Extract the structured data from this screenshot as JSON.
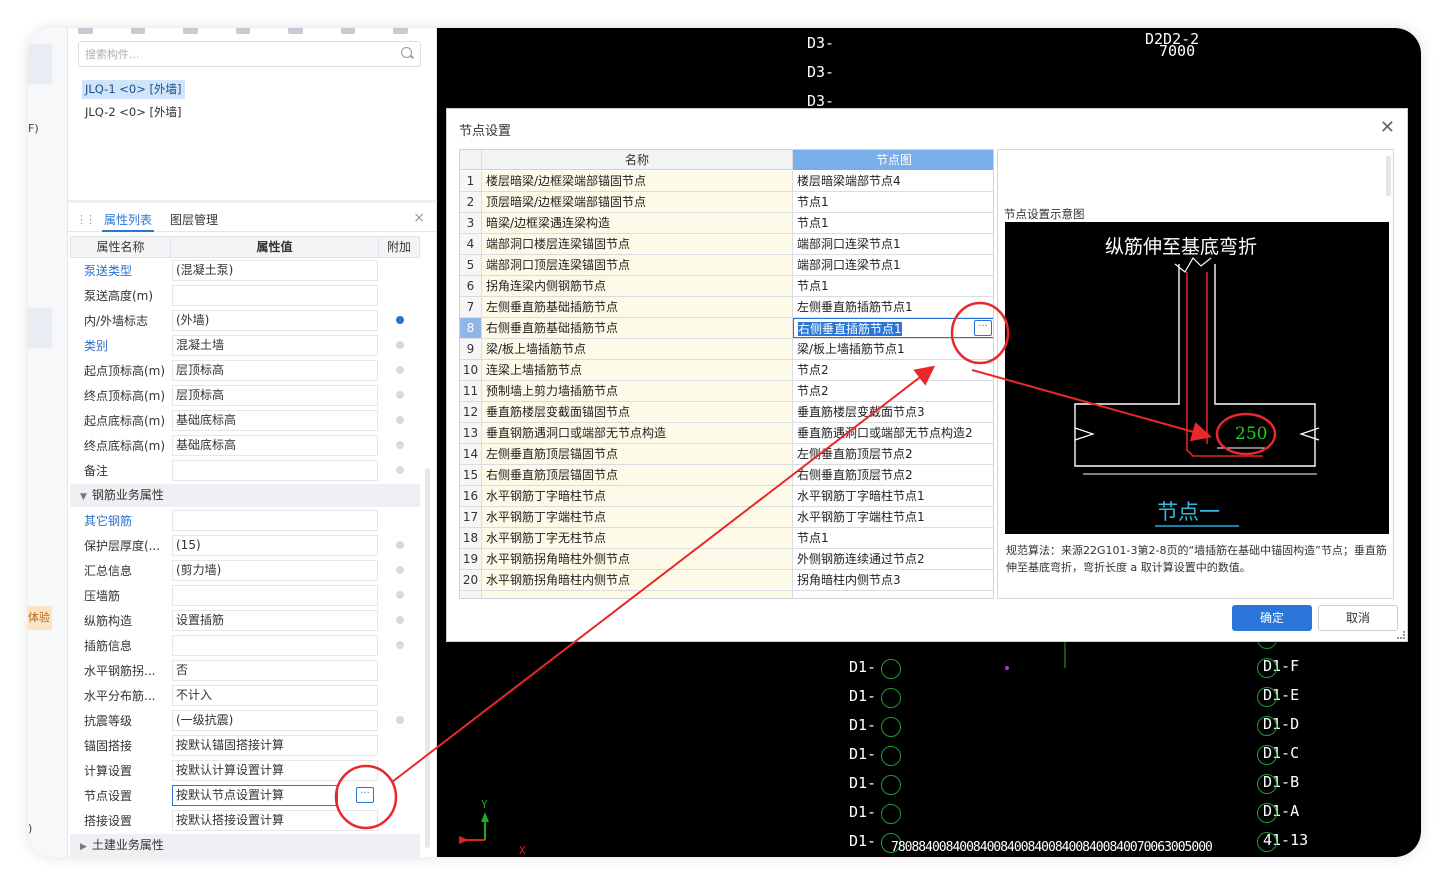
{
  "left_edge": {
    "text_top": "F)",
    "text_bottom": ")",
    "experience_tab": "体验"
  },
  "component_panel": {
    "search_placeholder": "搜索构件...",
    "items": [
      {
        "label": "JLQ-1 <0> [外墙]",
        "selected": true
      },
      {
        "label": "JLQ-2 <0> [外墙]",
        "selected": false
      }
    ]
  },
  "property_panel": {
    "tabs": [
      "属性列表",
      "图层管理"
    ],
    "columns": [
      "属性名称",
      "属性值",
      "附加"
    ],
    "rows": [
      {
        "name": "泵送类型",
        "value": "(混凝土泵)",
        "link": true,
        "dot": "none"
      },
      {
        "name": "泵送高度(m)",
        "value": "",
        "link": false,
        "dot": "none"
      },
      {
        "name": "内/外墙标志",
        "value": "(外墙)",
        "link": false,
        "dot": "blue"
      },
      {
        "name": "类别",
        "value": "混凝土墙",
        "link": true,
        "dot": "grey"
      },
      {
        "name": "起点顶标高(m)",
        "value": "层顶标高",
        "link": false,
        "dot": "grey"
      },
      {
        "name": "终点顶标高(m)",
        "value": "层顶标高",
        "link": false,
        "dot": "grey"
      },
      {
        "name": "起点底标高(m)",
        "value": "基础底标高",
        "link": false,
        "dot": "grey"
      },
      {
        "name": "终点底标高(m)",
        "value": "基础底标高",
        "link": false,
        "dot": "grey"
      },
      {
        "name": "备注",
        "value": "",
        "link": false,
        "dot": "grey"
      }
    ],
    "group_rebar": "钢筋业务属性",
    "rebar_rows": [
      {
        "name": "其它钢筋",
        "value": "",
        "link": true,
        "dot": "none"
      },
      {
        "name": "保护层厚度(...",
        "value": "(15)",
        "link": false,
        "dot": "grey"
      },
      {
        "name": "汇总信息",
        "value": "(剪力墙)",
        "link": false,
        "dot": "grey"
      },
      {
        "name": "压墙筋",
        "value": "",
        "link": false,
        "dot": "grey"
      },
      {
        "name": "纵筋构造",
        "value": "设置插筋",
        "link": false,
        "dot": "grey"
      },
      {
        "name": "插筋信息",
        "value": "",
        "link": false,
        "dot": "grey"
      },
      {
        "name": "水平钢筋拐...",
        "value": "否",
        "link": false,
        "dot": "none"
      },
      {
        "name": "水平分布筋...",
        "value": "不计入",
        "link": false,
        "dot": "none"
      },
      {
        "name": "抗震等级",
        "value": "(一级抗震)",
        "link": false,
        "dot": "grey"
      },
      {
        "name": "锚固搭接",
        "value": "按默认锚固搭接计算",
        "link": false,
        "dot": "none"
      },
      {
        "name": "计算设置",
        "value": "按默认计算设置计算",
        "link": false,
        "dot": "none"
      },
      {
        "name": "节点设置",
        "value": "按默认节点设置计算",
        "link": false,
        "dot": "none"
      },
      {
        "name": "搭接设置",
        "value": "按默认搭接设置计算",
        "link": false,
        "dot": "none"
      }
    ],
    "group_civil": "土建业务属性"
  },
  "cad": {
    "labels_top": [
      "D3-",
      "D3-",
      "D3-",
      "D2D2-2",
      "7000"
    ],
    "labels_left": [
      "D1-",
      "D1-",
      "D1-",
      "D1-",
      "D1-",
      "D1-",
      "D1-",
      "41-1"
    ],
    "labels_right": [
      "D1-G",
      "D1-F",
      "D1-E",
      "D1-D",
      "D1-C",
      "D1-B",
      "D1-A",
      "41-13"
    ],
    "bottom_dims": "78088400840084008400840084008400840070063005000",
    "axis_x": "X",
    "axis_y": "Y"
  },
  "dialog": {
    "title": "节点设置",
    "columns": [
      "名称",
      "节点图"
    ],
    "rows": [
      {
        "no": "1",
        "name": "楼层暗梁/边框梁端部锚固节点",
        "node": "楼层暗梁端部节点4"
      },
      {
        "no": "2",
        "name": "顶层暗梁/边框梁端部锚固节点",
        "node": "节点1"
      },
      {
        "no": "3",
        "name": "暗梁/边框梁遇连梁构造",
        "node": "节点1"
      },
      {
        "no": "4",
        "name": "端部洞口楼层连梁锚固节点",
        "node": "端部洞口连梁节点1"
      },
      {
        "no": "5",
        "name": "端部洞口顶层连梁锚固节点",
        "node": "端部洞口连梁节点1"
      },
      {
        "no": "6",
        "name": "拐角连梁内侧钢筋节点",
        "node": "节点1"
      },
      {
        "no": "7",
        "name": "左侧垂直筋基础插筋节点",
        "node": "左侧垂直筋插筋节点1"
      },
      {
        "no": "8",
        "name": "右侧垂直筋基础插筋节点",
        "node": "右侧垂直插筋节点1"
      },
      {
        "no": "9",
        "name": "梁/板上墙插筋节点",
        "node": "梁/板上墙插筋节点1"
      },
      {
        "no": "10",
        "name": "连梁上墙插筋节点",
        "node": "节点2"
      },
      {
        "no": "11",
        "name": "预制墙上剪力墙插筋节点",
        "node": "节点2"
      },
      {
        "no": "12",
        "name": "垂直筋楼层变截面锚固节点",
        "node": "垂直筋楼层变截面节点3"
      },
      {
        "no": "13",
        "name": "垂直钢筋遇洞口或端部无节点构造",
        "node": "垂直筋遇洞口或端部无节点构造2"
      },
      {
        "no": "14",
        "name": "左侧垂直筋顶层锚固节点",
        "node": "左侧垂直筋顶层节点2"
      },
      {
        "no": "15",
        "name": "右侧垂直筋顶层锚固节点",
        "node": "右侧垂直筋顶层节点2"
      },
      {
        "no": "16",
        "name": "水平钢筋丁字暗柱节点",
        "node": "水平钢筋丁字暗柱节点1"
      },
      {
        "no": "17",
        "name": "水平钢筋丁字端柱节点",
        "node": "水平钢筋丁字端柱节点1"
      },
      {
        "no": "18",
        "name": "水平钢筋丁字无柱节点",
        "node": "节点1"
      },
      {
        "no": "19",
        "name": "水平钢筋拐角暗柱外侧节点",
        "node": "外侧钢筋连续通过节点2"
      },
      {
        "no": "20",
        "name": "水平钢筋拐角暗柱内侧节点",
        "node": "拐角暗柱内侧节点3"
      }
    ],
    "selected_row": 8,
    "preview_title": "节点设置示意图",
    "preview_heading": "纵筋伸至基底弯折",
    "preview_dimension": "250",
    "preview_caption": "节点一",
    "preview_desc": "规范算法：来源22G101-3第2-8页的“墙插筋在基础中锚固构造”节点；垂直筋伸至基底弯折，弯折长度 a 取计算设置中的数值。",
    "ok": "确定",
    "cancel": "取消"
  },
  "colors": {
    "accent": "#2a75d8",
    "annotation_red": "#e8282c",
    "cad_green": "#1d9a33"
  }
}
